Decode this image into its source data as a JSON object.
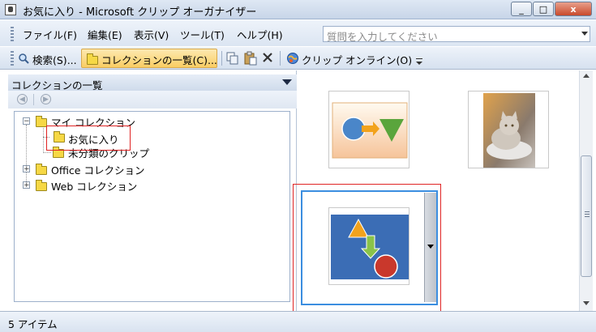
{
  "window": {
    "title": "お気に入り - Microsoft クリップ オーガナイザー",
    "controls": {
      "minimize": "_",
      "maximize": "□",
      "close": "x"
    }
  },
  "menubar": {
    "items": [
      {
        "label": "ファイル(F)",
        "icon": ""
      },
      {
        "label": "編集(E)"
      },
      {
        "label": "表示(V)"
      },
      {
        "label": "ツール(T)"
      },
      {
        "label": "ヘルプ(H)"
      }
    ],
    "ask_placeholder": "質問を入力してください"
  },
  "toolbar": {
    "search_label": "検索(S)...",
    "collections_label": "コレクションの一覧(C)...",
    "clips_online_label": "クリップ オンライン(O)"
  },
  "left_pane": {
    "header": "コレクションの一覧",
    "tree": {
      "my_collections": "マイ コレクション",
      "favorites": "お気に入り",
      "unclassified": "未分類のクリップ",
      "office": "Office コレクション",
      "web": "Web コレクション"
    }
  },
  "status": {
    "text": "5 アイテム"
  },
  "colors": {
    "highlight_red": "#e02424",
    "selection_blue": "#3b8ee0",
    "toolbar_active": "#f9cd63"
  },
  "icons": [
    "app-icon",
    "folder-icon",
    "back-icon",
    "forward-icon",
    "copy-icon",
    "paste-icon",
    "delete-icon",
    "globe-icon",
    "dropdown-icon"
  ]
}
